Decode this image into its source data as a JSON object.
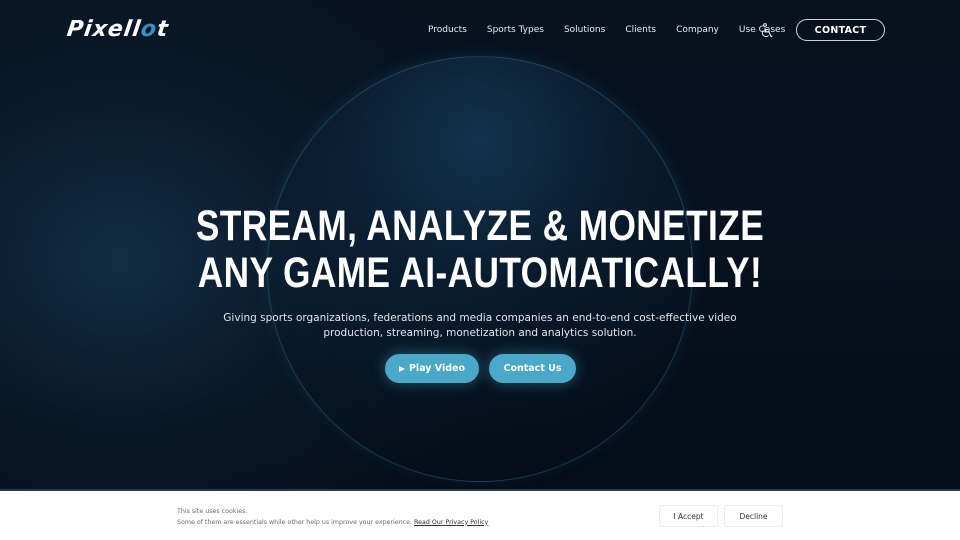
{
  "brand": {
    "logo_main": "Pixell",
    "logo_accent": "o",
    "logo_end": "t",
    "accent_color": "#3a8fc9"
  },
  "nav": {
    "items": [
      {
        "label": "Products"
      },
      {
        "label": "Sports Types"
      },
      {
        "label": "Solutions"
      },
      {
        "label": "Clients"
      },
      {
        "label": "Company"
      },
      {
        "label": "Use Cases"
      }
    ],
    "accessibility_icon": "accessibility-icon",
    "contact_label": "CONTACT"
  },
  "hero": {
    "headline_line1": "STREAM, ANALYZE & MONETIZE",
    "headline_line2": "ANY GAME AI-AUTOMATICALLY!",
    "subtext": "Giving sports organizations, federations and media companies an end-to-end cost-effective video production, streaming, monetization and analytics solution.",
    "play_video_label": "Play Video",
    "contact_us_label": "Contact Us",
    "button_color": "#4aa8c9"
  },
  "cookie": {
    "line1": "This site uses cookies.",
    "line2": "Some of them are essentials while other help us improve your experience.",
    "privacy_link": "Read Our Privacy Policy",
    "accept_label": "I Accept",
    "decline_label": "Decline"
  }
}
